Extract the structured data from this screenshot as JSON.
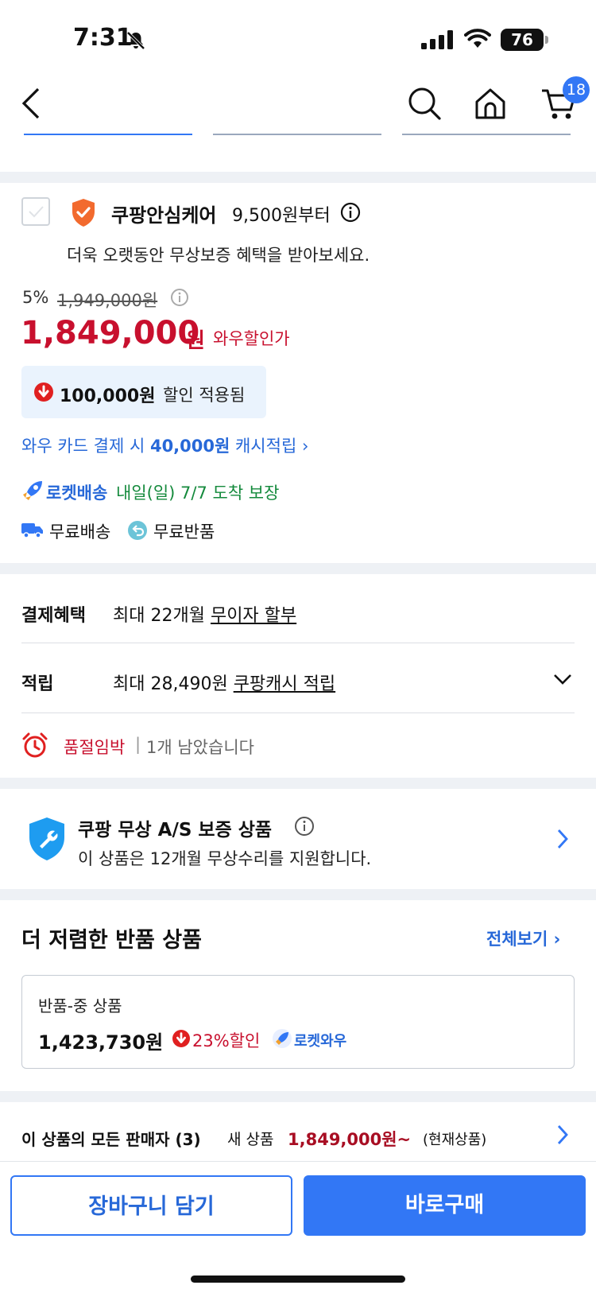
{
  "status_bar": {
    "time": "7:31",
    "battery": "76"
  },
  "nav": {
    "cart_count": "18"
  },
  "care": {
    "title": "쿠팡안심케어",
    "price_from": "9,500원부터",
    "desc": "더욱 오랫동안 무상보증 혜택을 받아보세요."
  },
  "price": {
    "discount_rate": "5%",
    "original": "1,949,000원",
    "sale_value": "1,849,000",
    "sale_unit": "원",
    "sale_tag": "와우할인가",
    "discount_amount": "100,000원",
    "discount_label": "할인 적용됨"
  },
  "card_cash": {
    "prefix": "와우 카드 결제 시 ",
    "amount": "40,000원",
    "suffix": " 캐시적립"
  },
  "delivery": {
    "rocket": "로켓배송",
    "eta": "내일(일) 7/7 도착 보장",
    "free_ship": "무료배송",
    "free_return": "무료반품"
  },
  "benefits": {
    "payment_label": "결제혜택",
    "payment_prefix": "최대 22개월 ",
    "payment_link": "무이자 할부",
    "point_label": "적립",
    "point_prefix": "최대 28,490원 ",
    "point_link": "쿠팡캐시 적립"
  },
  "stock": {
    "status": "품절임박",
    "remaining": "1개 남았습니다"
  },
  "as_warranty": {
    "title": "쿠팡 무상 A/S 보증 상품",
    "desc": "이 상품은 12개월 무상수리를 지원합니다."
  },
  "returns": {
    "heading": "더 저렴한 반품 상품",
    "view_all": "전체보기",
    "item_condition": "반품-중 상품",
    "item_price": "1,423,730원",
    "item_discount": "23%할인",
    "item_badge": "로켓와우"
  },
  "sellers": {
    "label": "이 상품의 모든 판매자 (3)",
    "new_label": "새 상품",
    "price": "1,849,000원~",
    "current": "(현재상품)"
  },
  "actions": {
    "cart": "장바구니 담기",
    "buy": "바로구매"
  },
  "colors": {
    "accent_blue": "#3277f5",
    "price_red": "#c8102e",
    "green": "#148a3c"
  }
}
